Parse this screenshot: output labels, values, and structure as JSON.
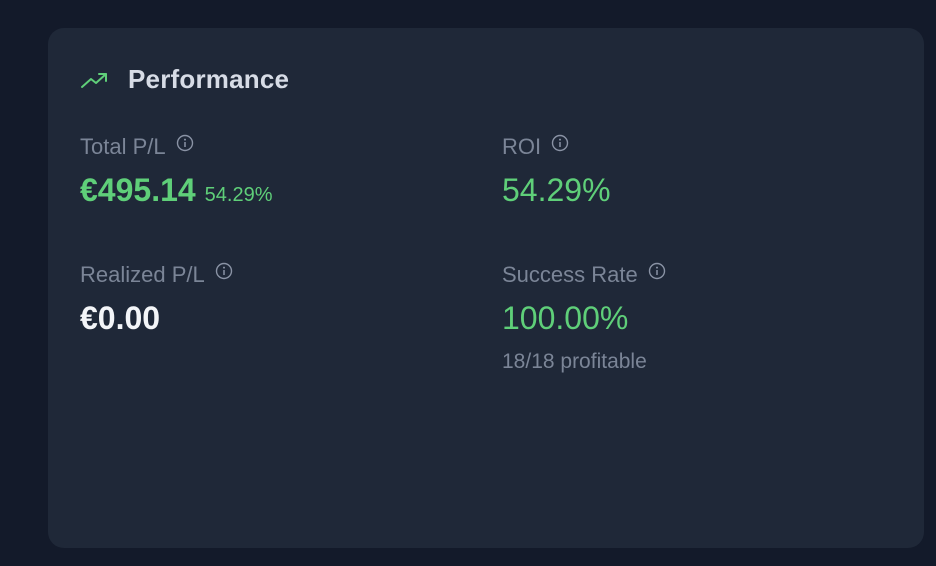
{
  "card": {
    "title": "Performance",
    "icon": "trending-up-icon",
    "accent_color": "#5fcf79"
  },
  "metrics": {
    "total_pl": {
      "label": "Total P/L",
      "value": "€495.14",
      "percent": "54.29%"
    },
    "roi": {
      "label": "ROI",
      "value": "54.29%"
    },
    "realized_pl": {
      "label": "Realized P/L",
      "value": "€0.00"
    },
    "success_rate": {
      "label": "Success Rate",
      "value": "100.00%",
      "note": "18/18 profitable"
    }
  }
}
